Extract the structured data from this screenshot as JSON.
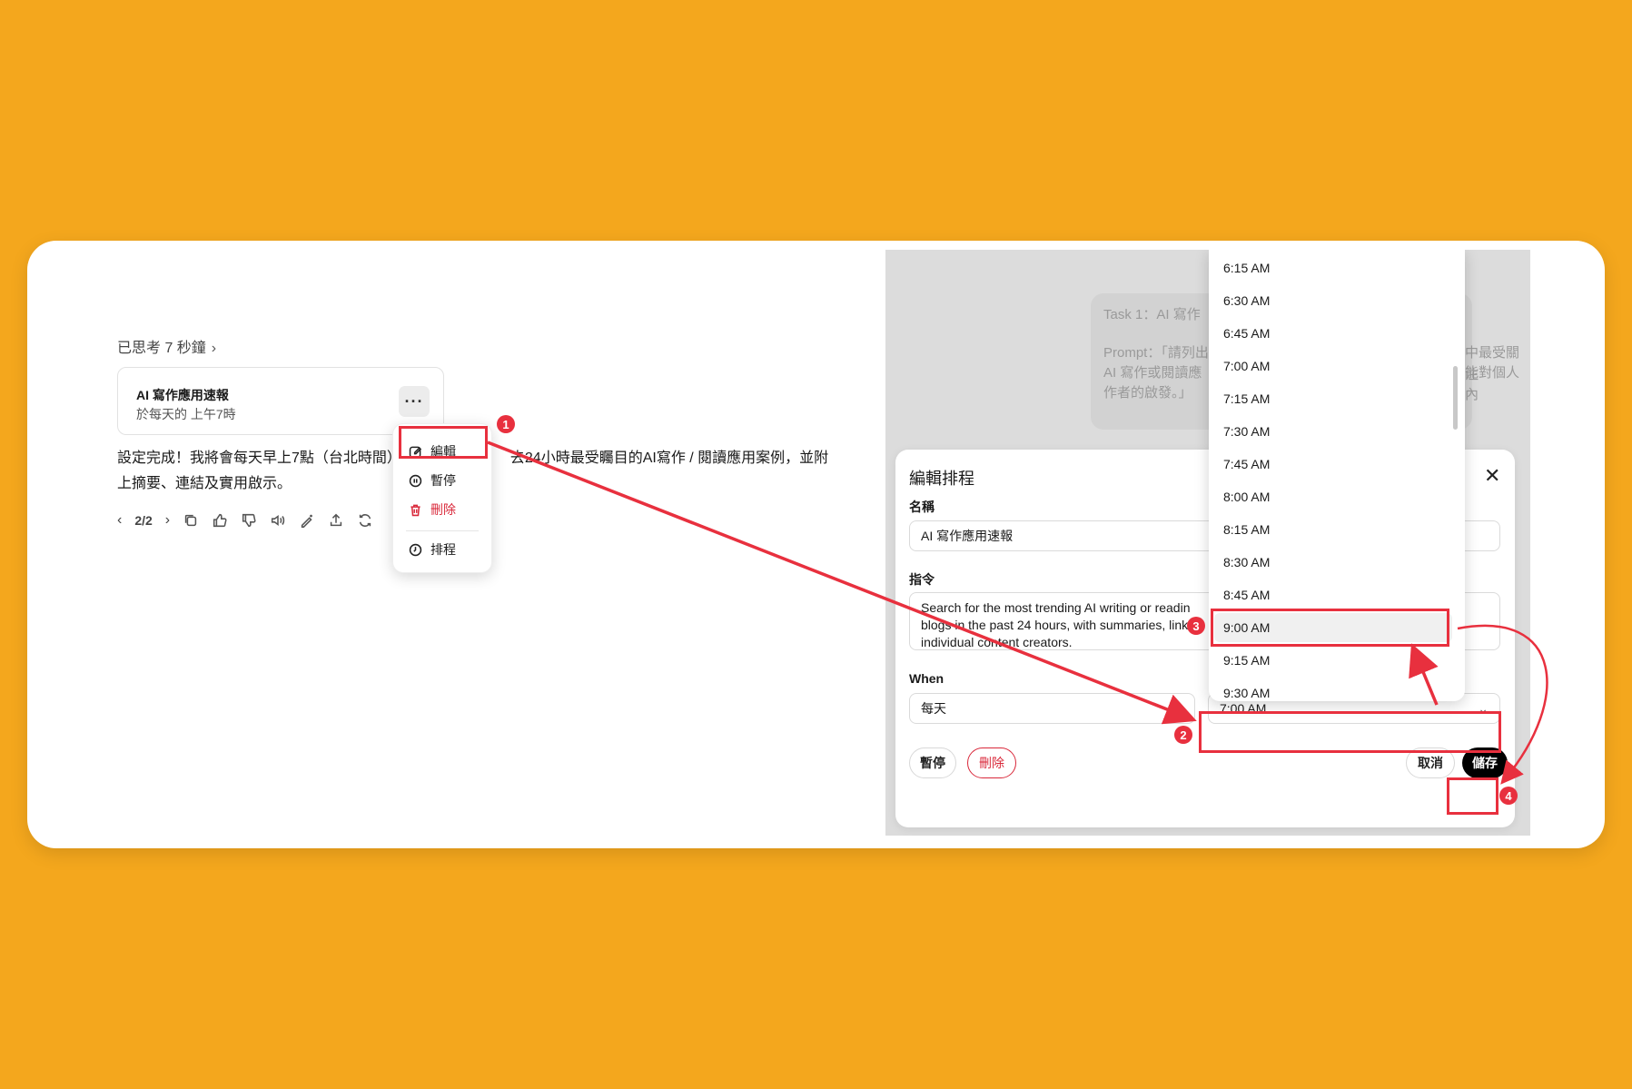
{
  "chat": {
    "thought_label": "已思考 7 秒鐘",
    "task_title": "AI 寫作應用速報",
    "task_schedule": "於每天的 上午7時",
    "more_label": "···",
    "reply_line1": "設定完成！我將會每天早上7點（台北時間）",
    "reply_line1b": "去24小時最受矚目的AI寫作 / 閱讀應用案例，並附",
    "reply_line2": "上摘要、連結及實用啟示。",
    "pager": "2/2"
  },
  "menu": {
    "edit": "編輯",
    "pause": "暫停",
    "delete": "刪除",
    "schedule": "排程"
  },
  "background": {
    "task_line": "Task 1：AI 寫作",
    "prompt_line1": "Prompt：「請列出",
    "prompt_line2": "AI 寫作或閱讀應",
    "prompt_line3": "作者的啟發。」",
    "right_line1": "中最受關注",
    "right_line2": "能對個人內"
  },
  "modal": {
    "title": "編輯排程",
    "name_label": "名稱",
    "name_value": "AI 寫作應用速報",
    "instruction_label": "指令",
    "instruction_line1": "Search for the most trending AI writing or readin",
    "instruction_line2": "blogs in the past 24 hours, with summaries, links,",
    "instruction_line3": "individual content creators.",
    "when_label": "When",
    "frequency_value": "每天",
    "time_value": "7:00 AM",
    "pause_button": "暫停",
    "delete_button": "刪除",
    "cancel_button": "取消",
    "save_button": "儲存"
  },
  "dropdown": {
    "options": [
      "6:15 AM",
      "6:30 AM",
      "6:45 AM",
      "7:00 AM",
      "7:15 AM",
      "7:30 AM",
      "7:45 AM",
      "8:00 AM",
      "8:15 AM",
      "8:30 AM",
      "8:45 AM",
      "9:00 AM",
      "9:15 AM",
      "9:30 AM"
    ],
    "selected": "9:00 AM"
  },
  "annotations": {
    "step1": "1",
    "step2": "2",
    "step3": "3",
    "step4": "4",
    "color": "#e8303e"
  }
}
